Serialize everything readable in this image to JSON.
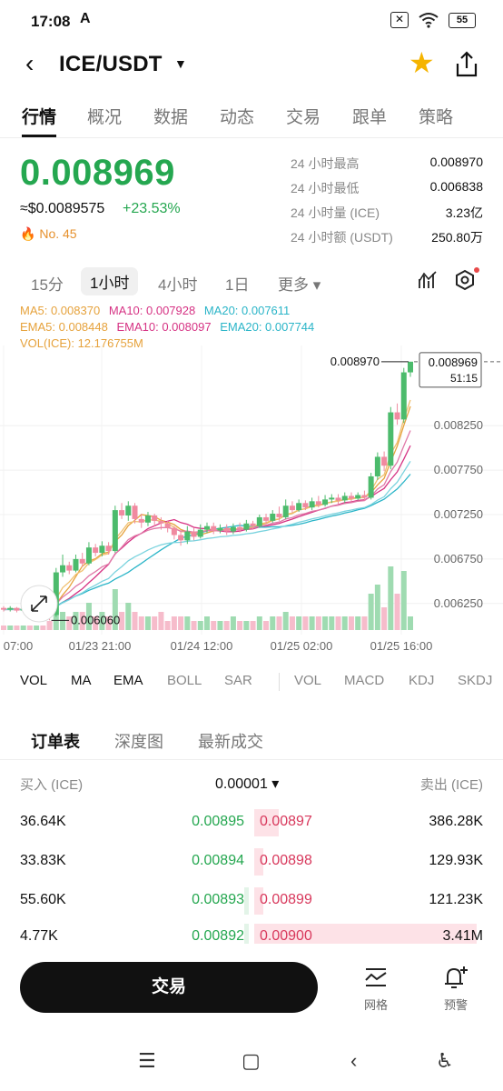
{
  "status_bar": {
    "time": "17:08",
    "a_glyph": "A",
    "battery": "55"
  },
  "header": {
    "pair": "ICE/USDT"
  },
  "tabs": [
    {
      "label": "行情",
      "active": true
    },
    {
      "label": "概况"
    },
    {
      "label": "数据"
    },
    {
      "label": "动态"
    },
    {
      "label": "交易"
    },
    {
      "label": "跟单"
    },
    {
      "label": "策略"
    }
  ],
  "ticker": {
    "price": "0.008969",
    "usd_price": "≈$0.0089575",
    "change": "+23.53%",
    "rank": "No. 45",
    "stats": [
      {
        "label": "24 小时最高",
        "value": "0.008970"
      },
      {
        "label": "24 小时最低",
        "value": "0.006838"
      },
      {
        "label": "24 小时量 (ICE)",
        "value": "3.23亿"
      },
      {
        "label": "24 小时额 (USDT)",
        "value": "250.80万"
      }
    ]
  },
  "intervals": [
    {
      "label": "15分"
    },
    {
      "label": "1小时",
      "active": true
    },
    {
      "label": "4小时"
    },
    {
      "label": "1日"
    },
    {
      "label": "更多 ▾"
    }
  ],
  "legend": {
    "line1": [
      {
        "text": "MA5: 0.008370",
        "color": "#e6a23c"
      },
      {
        "text": "MA10: 0.007928",
        "color": "#d63384"
      },
      {
        "text": "MA20: 0.007611",
        "color": "#2bb5c8"
      }
    ],
    "line2": [
      {
        "text": "EMA5: 0.008448",
        "color": "#e6a23c"
      },
      {
        "text": "EMA10: 0.008097",
        "color": "#d63384"
      },
      {
        "text": "EMA20: 0.007744",
        "color": "#2bb5c8"
      }
    ],
    "line3": [
      {
        "text": "VOL(ICE): 12.176755M",
        "color": "#e6a23c"
      }
    ]
  },
  "chart_data": {
    "type": "candlestick",
    "x_ticks": [
      "07:00",
      "01/23 21:00",
      "01/24 12:00",
      "01/25 02:00",
      "01/25 16:00"
    ],
    "y_ticks": [
      0.00825,
      0.00775,
      0.00725,
      0.00675,
      0.00625
    ],
    "y_tick_labels": [
      "0.008250",
      "0.007750",
      "0.007250",
      "0.006750",
      "0.006250"
    ],
    "ylim": [
      0.0059,
      0.00905
    ],
    "high_label": "0.008970",
    "low_label": "0.006060",
    "last_price_label": "0.008969",
    "countdown": "51:15",
    "up_color": "#4cbb6c",
    "down_color": "#f08aa0",
    "candles": [
      [
        0.0062,
        0.00618,
        0.00622,
        0.00616
      ],
      [
        0.00618,
        0.0062,
        0.00622,
        0.00616
      ],
      [
        0.0062,
        0.00617,
        0.00621,
        0.00615
      ],
      [
        0.00617,
        0.00619,
        0.00621,
        0.00615
      ],
      [
        0.00619,
        0.00616,
        0.0062,
        0.00614
      ],
      [
        0.00616,
        0.00618,
        0.0062,
        0.00614
      ],
      [
        0.00618,
        0.00615,
        0.00619,
        0.00613
      ],
      [
        0.00615,
        0.00612,
        0.00617,
        0.00606
      ],
      [
        0.00612,
        0.0066,
        0.00665,
        0.0061
      ],
      [
        0.0066,
        0.00668,
        0.0068,
        0.00655
      ],
      [
        0.00668,
        0.00662,
        0.00672,
        0.00658
      ],
      [
        0.00662,
        0.00675,
        0.0068,
        0.0066
      ],
      [
        0.00675,
        0.0067,
        0.00682,
        0.00666
      ],
      [
        0.0067,
        0.00688,
        0.00694,
        0.00668
      ],
      [
        0.00688,
        0.00682,
        0.00692,
        0.00678
      ],
      [
        0.00682,
        0.0069,
        0.00695,
        0.00678
      ],
      [
        0.0069,
        0.00684,
        0.00694,
        0.0068
      ],
      [
        0.00684,
        0.0073,
        0.00735,
        0.00682
      ],
      [
        0.0073,
        0.00724,
        0.00738,
        0.0072
      ],
      [
        0.00724,
        0.00735,
        0.0074,
        0.00718
      ],
      [
        0.00735,
        0.0072,
        0.00738,
        0.00715
      ],
      [
        0.0072,
        0.00716,
        0.00726,
        0.0071
      ],
      [
        0.00716,
        0.00724,
        0.00728,
        0.00712
      ],
      [
        0.00724,
        0.00718,
        0.00726,
        0.00712
      ],
      [
        0.00718,
        0.00715,
        0.00722,
        0.00708
      ],
      [
        0.00715,
        0.0071,
        0.00718,
        0.00705
      ],
      [
        0.0071,
        0.00702,
        0.00712,
        0.00697
      ],
      [
        0.00702,
        0.00696,
        0.00706,
        0.0069
      ],
      [
        0.00696,
        0.00706,
        0.00712,
        0.00692
      ],
      [
        0.00706,
        0.007,
        0.0071,
        0.00696
      ],
      [
        0.007,
        0.00708,
        0.00714,
        0.00698
      ],
      [
        0.00708,
        0.00712,
        0.00716,
        0.00704
      ],
      [
        0.00712,
        0.00707,
        0.00716,
        0.00703
      ],
      [
        0.00707,
        0.0071,
        0.00714,
        0.00704
      ],
      [
        0.0071,
        0.00706,
        0.00714,
        0.00702
      ],
      [
        0.00706,
        0.00711,
        0.00715,
        0.00703
      ],
      [
        0.00711,
        0.00708,
        0.00716,
        0.00705
      ],
      [
        0.00708,
        0.00715,
        0.00719,
        0.00706
      ],
      [
        0.00715,
        0.00712,
        0.00718,
        0.00708
      ],
      [
        0.00712,
        0.00722,
        0.00725,
        0.0071
      ],
      [
        0.00722,
        0.00718,
        0.00726,
        0.00714
      ],
      [
        0.00718,
        0.00726,
        0.0073,
        0.00716
      ],
      [
        0.00726,
        0.00722,
        0.00734,
        0.00718
      ],
      [
        0.00722,
        0.00735,
        0.00742,
        0.0072
      ],
      [
        0.00735,
        0.0073,
        0.0074,
        0.00727
      ],
      [
        0.0073,
        0.00738,
        0.00742,
        0.00728
      ],
      [
        0.00738,
        0.00733,
        0.00741,
        0.0073
      ],
      [
        0.00733,
        0.0074,
        0.00744,
        0.0073
      ],
      [
        0.0074,
        0.00736,
        0.00746,
        0.00733
      ],
      [
        0.00736,
        0.00742,
        0.00747,
        0.00734
      ],
      [
        0.00742,
        0.00744,
        0.00748,
        0.00738
      ],
      [
        0.00744,
        0.00741,
        0.00748,
        0.00737
      ],
      [
        0.00741,
        0.00746,
        0.0075,
        0.00738
      ],
      [
        0.00746,
        0.00743,
        0.0075,
        0.0074
      ],
      [
        0.00743,
        0.00747,
        0.0075,
        0.00741
      ],
      [
        0.00747,
        0.00744,
        0.00752,
        0.00741
      ],
      [
        0.00744,
        0.00768,
        0.00772,
        0.00742
      ],
      [
        0.00768,
        0.0079,
        0.00795,
        0.00764
      ],
      [
        0.0079,
        0.0078,
        0.00796,
        0.00774
      ],
      [
        0.0078,
        0.0084,
        0.00846,
        0.00776
      ],
      [
        0.0084,
        0.00832,
        0.0085,
        0.00826
      ],
      [
        0.00832,
        0.00885,
        0.0089,
        0.00828
      ],
      [
        0.00885,
        0.00897,
        0.00897,
        0.0088
      ]
    ],
    "volumes": [
      1,
      1,
      1,
      1,
      1,
      1,
      1,
      2,
      8,
      4,
      3,
      4,
      4,
      6,
      3,
      4,
      3,
      9,
      4,
      6,
      4,
      3,
      3,
      3,
      4,
      2,
      3,
      3,
      3,
      2,
      2,
      3,
      2,
      2,
      2,
      3,
      2,
      2,
      2,
      3,
      2,
      3,
      3,
      4,
      3,
      3,
      3,
      3,
      3,
      3,
      3,
      3,
      3,
      3,
      3,
      3,
      8,
      10,
      5,
      14,
      8,
      13,
      3
    ]
  },
  "indicator_tabs": {
    "main": [
      {
        "label": "VOL",
        "on": true
      },
      {
        "label": "MA",
        "on": true
      },
      {
        "label": "EMA",
        "on": true
      },
      {
        "label": "BOLL",
        "on": false
      },
      {
        "label": "SAR",
        "on": false
      }
    ],
    "sub": [
      {
        "label": "VOL",
        "on": false
      },
      {
        "label": "MACD",
        "on": false
      },
      {
        "label": "KDJ",
        "on": false
      },
      {
        "label": "SKDJ",
        "on": false
      }
    ]
  },
  "order_book": {
    "tabs": [
      {
        "label": "订单表",
        "active": true
      },
      {
        "label": "深度图"
      },
      {
        "label": "最新成交"
      }
    ],
    "bid_header": "买入 (ICE)",
    "precision": "0.00001 ▾",
    "ask_header": "卖出 (ICE)",
    "rows": [
      {
        "bid_qty": "36.64K",
        "bid_price": "0.00895",
        "ask_price": "0.00897",
        "ask_qty": "386.28K",
        "bid_depth": 0.0,
        "ask_depth": 0.11
      },
      {
        "bid_qty": "33.83K",
        "bid_price": "0.00894",
        "ask_price": "0.00898",
        "ask_qty": "129.93K",
        "bid_depth": 0.0,
        "ask_depth": 0.04
      },
      {
        "bid_qty": "55.60K",
        "bid_price": "0.00893",
        "ask_price": "0.00899",
        "ask_qty": "121.23K",
        "bid_depth": 0.02,
        "ask_depth": 0.04
      },
      {
        "bid_qty": "4.77K",
        "bid_price": "0.00892",
        "ask_price": "0.00900",
        "ask_qty": "3.41M",
        "bid_depth": 0.02,
        "ask_depth": 1.0
      }
    ]
  },
  "bottom_bar": {
    "trade": "交易",
    "grid": "网格",
    "alert": "预警"
  }
}
